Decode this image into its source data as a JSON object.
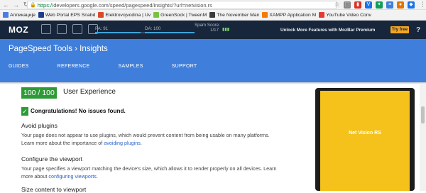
{
  "browser": {
    "url_prefix": "https://",
    "url_rest": "developers.google.com/speed/pagespeed/insights/?url=netvision.rs",
    "bookmarks": [
      {
        "label": "Апликације",
        "color": "#4a7ee0"
      },
      {
        "label": "Web Portal EPS Snabd",
        "color": "#1f3e8c"
      },
      {
        "label": "Elektrovojvodina | Uv",
        "color": "#d94a2b"
      },
      {
        "label": "GreenSock | TweenM",
        "color": "#79c142"
      },
      {
        "label": "The November Man",
        "color": "#3a3a3a"
      },
      {
        "label": "XAMPP Application M",
        "color": "#f57c00"
      },
      {
        "label": "YouTube Video Conv",
        "color": "#e53935"
      }
    ]
  },
  "mozbar": {
    "logo": "MOZ",
    "pa_label": "PA: 91",
    "pa_value": 0.91,
    "da_label": "DA: 100",
    "da_value": 1.0,
    "spam_label": "Spam Score:",
    "spam_value": "1/17",
    "unlock_text": "Unlock More Features with MozBar Premium",
    "try_free": "Try free",
    "help": "?"
  },
  "pagespeed": {
    "title": "PageSpeed Tools  ›  Insights",
    "tabs": [
      "GUIDES",
      "REFERENCE",
      "SAMPLES",
      "SUPPORT"
    ]
  },
  "result": {
    "score": "100 / 100",
    "score_label": "User Experience",
    "congrats": "Congratulations! No issues found.",
    "sections": [
      {
        "heading": "Avoid plugins",
        "text_1": "Your page does not appear to use plugins, which would prevent content from being usable on many platforms.",
        "text_2_pre": "Learn more about the importance of ",
        "link": "avoiding plugins",
        "text_2_post": "."
      },
      {
        "heading": "Configure the viewport",
        "text_1": "Your page specifies a viewport matching the device's size, which allows it to render properly on all devices. Learn",
        "text_2_pre": "more about ",
        "link": "configuring viewports",
        "text_2_post": "."
      },
      {
        "heading": "Size content to viewport"
      }
    ]
  },
  "preview": {
    "site_name": "Net Vision RS"
  }
}
